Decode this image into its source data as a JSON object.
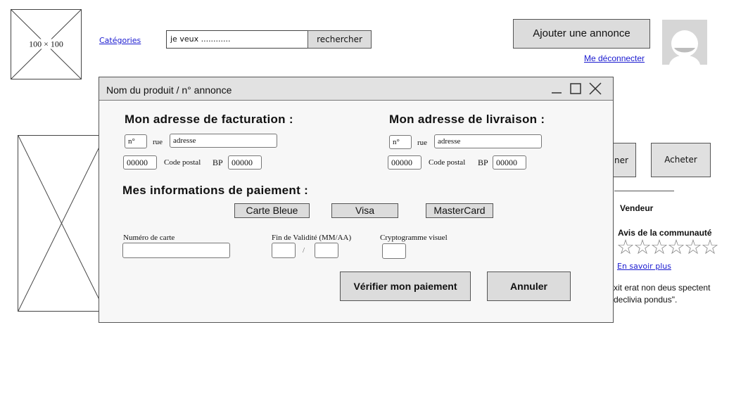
{
  "header": {
    "logo_placeholder": "100 × 100",
    "categories_link": "Catégories",
    "search_value": "je veux ............",
    "search_button": "rechercher",
    "add_listing_button": "Ajouter une annonce",
    "logout_link": "Me déconnecter"
  },
  "background": {
    "side_button_partial": "ner",
    "buy_button": "Acheter",
    "seller_label": "Vendeur",
    "community_review_label": "Avis de la communauté",
    "stars": "☆☆☆☆☆☆",
    "learn_more_link": "En savoir plus",
    "description_line1": "xit erat non deus spectent",
    "description_line2": "declivia pondus\"."
  },
  "dialog": {
    "title": "Nom du produit / n° annonce",
    "billing": {
      "heading": "Mon adresse de facturation :",
      "number_value": "n°",
      "street_label": "rue",
      "street_value": "adresse",
      "postal_value": "00000",
      "postal_label": "Code postal",
      "bp_label": "BP",
      "bp_value": "00000"
    },
    "delivery": {
      "heading": "Mon adresse de livraison :",
      "number_value": "n°",
      "street_label": "rue",
      "street_value": "adresse",
      "postal_value": "00000",
      "postal_label": "Code postal",
      "bp_label": "BP",
      "bp_value": "00000"
    },
    "payment": {
      "heading": "Mes informations de paiement :",
      "card_types": [
        "Carte Bleue",
        "Visa",
        "MasterCard"
      ],
      "card_number_label": "Numéro de carte",
      "expiry_label": "Fin de Validité (MM/AA)",
      "expiry_separator": "/",
      "cvv_label": "Cryptogramme visuel"
    },
    "verify_button": "Vérifier mon paiement",
    "cancel_button": "Annuler"
  }
}
